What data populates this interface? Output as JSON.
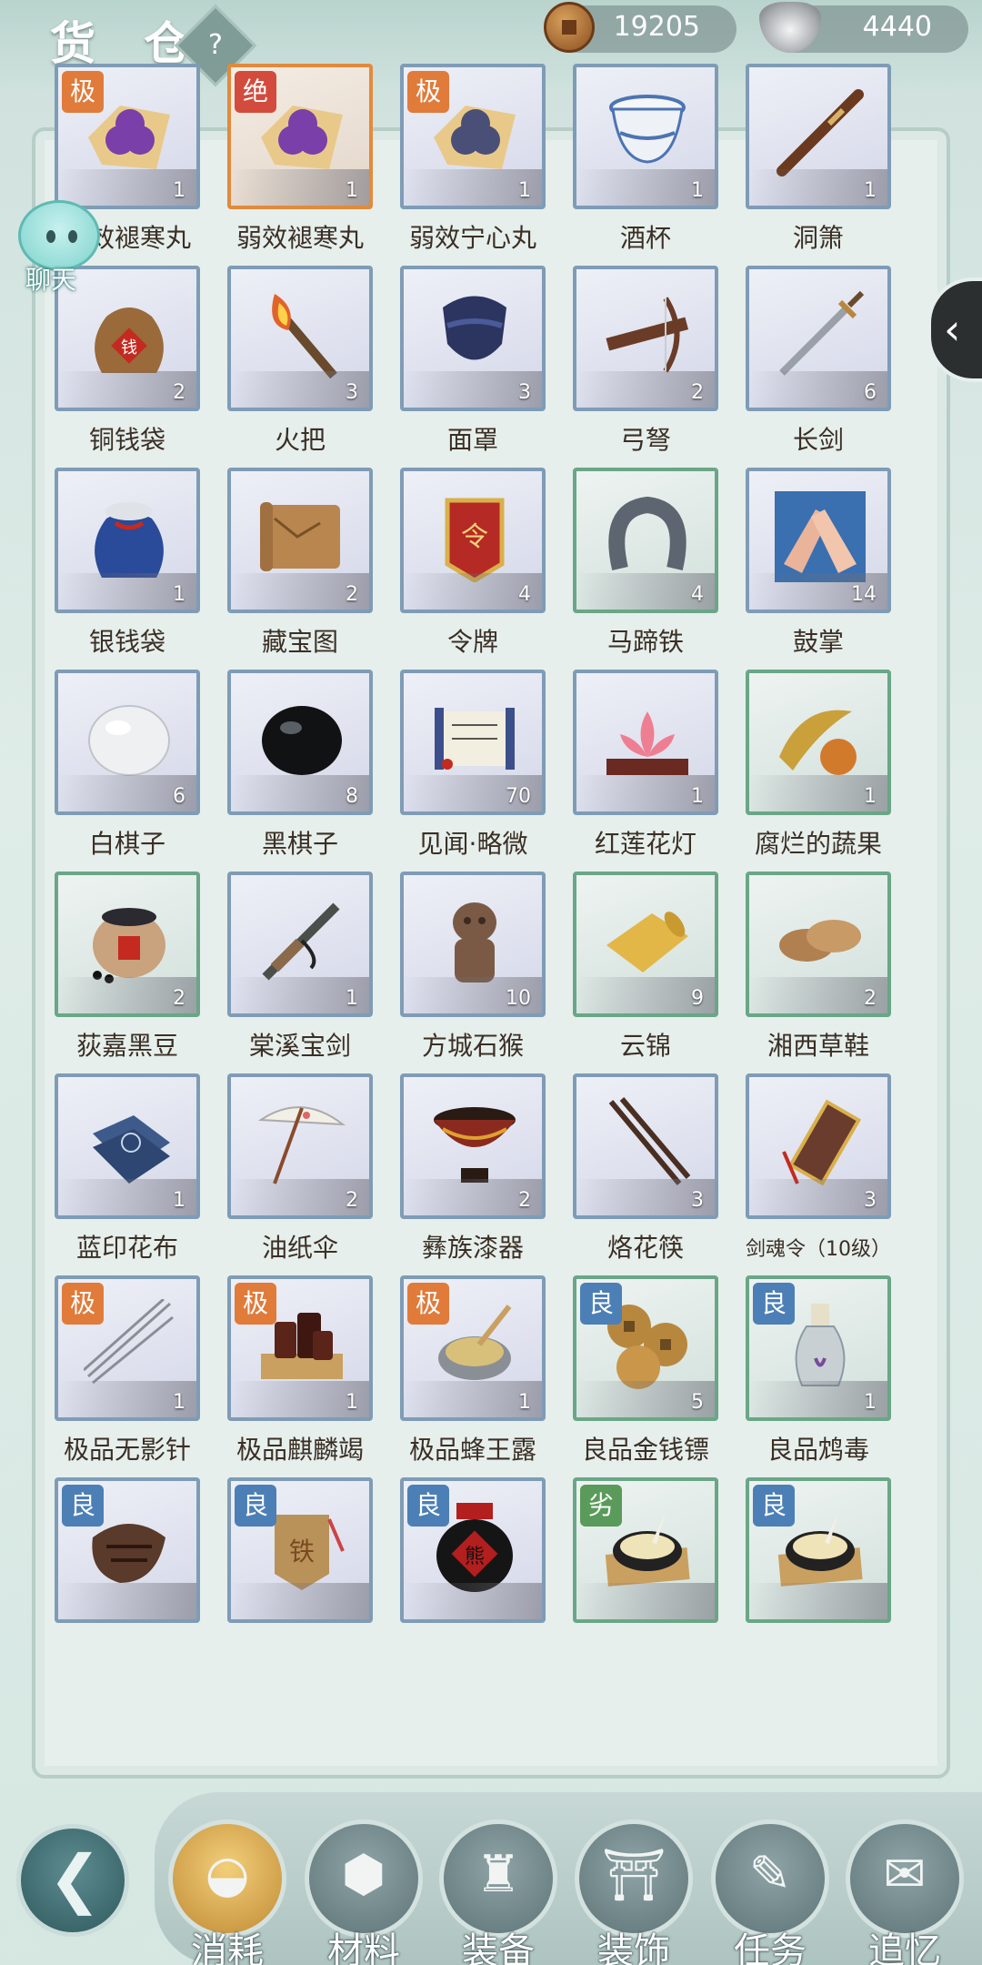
{
  "header": {
    "title": "货 仓",
    "help_label": "?"
  },
  "currency": {
    "coins": "19205",
    "silver": "4440"
  },
  "chat": {
    "label": "聊天"
  },
  "side_arrow": "‹",
  "items": [
    {
      "name": "弱效褪寒丸",
      "count": "1",
      "badge": "极",
      "badge_type": "ji",
      "rarity": "blue",
      "icon": "pill-icon",
      "color": "#7a3fa8"
    },
    {
      "name": "弱效褪寒丸",
      "count": "1",
      "badge": "绝",
      "badge_type": "jue",
      "rarity": "orange",
      "icon": "pill-icon",
      "color": "#7a3fa8"
    },
    {
      "name": "弱效宁心丸",
      "count": "1",
      "badge": "极",
      "badge_type": "ji",
      "rarity": "blue",
      "icon": "pill-icon",
      "color": "#4a4f78"
    },
    {
      "name": "酒杯",
      "count": "1",
      "badge": "",
      "badge_type": "",
      "rarity": "blue",
      "icon": "cup-icon",
      "color": "#4c74b3"
    },
    {
      "name": "洞箫",
      "count": "1",
      "badge": "",
      "badge_type": "",
      "rarity": "blue",
      "icon": "flute-icon",
      "color": "#6b3a1e"
    },
    {
      "name": "铜钱袋",
      "count": "2",
      "badge": "",
      "badge_type": "",
      "rarity": "blue",
      "icon": "money-bag-icon",
      "color": "#9a6a3a"
    },
    {
      "name": "火把",
      "count": "3",
      "badge": "",
      "badge_type": "",
      "rarity": "blue",
      "icon": "torch-icon",
      "color": "#e0632a"
    },
    {
      "name": "面罩",
      "count": "3",
      "badge": "",
      "badge_type": "",
      "rarity": "blue",
      "icon": "mask-icon",
      "color": "#2c3560"
    },
    {
      "name": "弓弩",
      "count": "2",
      "badge": "",
      "badge_type": "",
      "rarity": "blue",
      "icon": "crossbow-icon",
      "color": "#6a3c28"
    },
    {
      "name": "长剑",
      "count": "6",
      "badge": "",
      "badge_type": "",
      "rarity": "blue",
      "icon": "sword-icon",
      "color": "#9aa0a8"
    },
    {
      "name": "银钱袋",
      "count": "1",
      "badge": "",
      "badge_type": "",
      "rarity": "blue",
      "icon": "silver-bag-icon",
      "color": "#2a4a9a"
    },
    {
      "name": "藏宝图",
      "count": "2",
      "badge": "",
      "badge_type": "",
      "rarity": "blue",
      "icon": "map-icon",
      "color": "#b8864e"
    },
    {
      "name": "令牌",
      "count": "4",
      "badge": "",
      "badge_type": "",
      "rarity": "blue",
      "icon": "token-icon",
      "color": "#b52a24"
    },
    {
      "name": "马蹄铁",
      "count": "4",
      "badge": "",
      "badge_type": "",
      "rarity": "green",
      "icon": "horseshoe-icon",
      "color": "#5d6570"
    },
    {
      "name": "鼓掌",
      "count": "14",
      "badge": "",
      "badge_type": "",
      "rarity": "blue",
      "icon": "clap-icon",
      "color": "#e9b49a"
    },
    {
      "name": "白棋子",
      "count": "6",
      "badge": "",
      "badge_type": "",
      "rarity": "blue",
      "icon": "white-stone-icon",
      "color": "#eef0f2"
    },
    {
      "name": "黑棋子",
      "count": "8",
      "badge": "",
      "badge_type": "",
      "rarity": "blue",
      "icon": "black-stone-icon",
      "color": "#101214"
    },
    {
      "name": "见闻·略微",
      "count": "70",
      "badge": "",
      "badge_type": "",
      "rarity": "blue",
      "icon": "scroll-icon",
      "color": "#3c4f8a"
    },
    {
      "name": "红莲花灯",
      "count": "1",
      "badge": "",
      "badge_type": "",
      "rarity": "blue",
      "icon": "lotus-lamp-icon",
      "color": "#ee7f92"
    },
    {
      "name": "腐烂的蔬果",
      "count": "1",
      "badge": "",
      "badge_type": "",
      "rarity": "green",
      "icon": "rotten-fruit-icon",
      "color": "#c9a03a"
    },
    {
      "name": "荻嘉黑豆",
      "count": "2",
      "badge": "",
      "badge_type": "",
      "rarity": "green",
      "icon": "bean-jar-icon",
      "color": "#c9a27e"
    },
    {
      "name": "棠溪宝剑",
      "count": "1",
      "badge": "",
      "badge_type": "",
      "rarity": "blue",
      "icon": "sheathed-sword-icon",
      "color": "#4a4f4a"
    },
    {
      "name": "方城石猴",
      "count": "10",
      "badge": "",
      "badge_type": "",
      "rarity": "blue",
      "icon": "stone-monkey-icon",
      "color": "#7a5a45"
    },
    {
      "name": "云锦",
      "count": "9",
      "badge": "",
      "badge_type": "",
      "rarity": "green",
      "icon": "brocade-icon",
      "color": "#e2b748"
    },
    {
      "name": "湘西草鞋",
      "count": "2",
      "badge": "",
      "badge_type": "",
      "rarity": "green",
      "icon": "straw-shoes-icon",
      "color": "#b08050"
    },
    {
      "name": "蓝印花布",
      "count": "1",
      "badge": "",
      "badge_type": "",
      "rarity": "blue",
      "icon": "cloth-icon",
      "color": "#3d5a8a"
    },
    {
      "name": "油纸伞",
      "count": "2",
      "badge": "",
      "badge_type": "",
      "rarity": "blue",
      "icon": "umbrella-icon",
      "color": "#f1efe6"
    },
    {
      "name": "彝族漆器",
      "count": "2",
      "badge": "",
      "badge_type": "",
      "rarity": "blue",
      "icon": "lacquer-bowl-icon",
      "color": "#8a2a1e"
    },
    {
      "name": "烙花筷",
      "count": "3",
      "badge": "",
      "badge_type": "",
      "rarity": "blue",
      "icon": "chopsticks-icon",
      "color": "#4a2e22"
    },
    {
      "name": "剑魂令（10级）",
      "count": "3",
      "badge": "",
      "badge_type": "",
      "rarity": "blue",
      "icon": "sword-token-icon",
      "color": "#6a3c2e",
      "small": true
    },
    {
      "name": "极品无影针",
      "count": "1",
      "badge": "极",
      "badge_type": "ji",
      "rarity": "blue",
      "icon": "needle-icon",
      "color": "#8a8f96"
    },
    {
      "name": "极品麒麟竭",
      "count": "1",
      "badge": "极",
      "badge_type": "ji",
      "rarity": "blue",
      "icon": "resin-icon",
      "color": "#5a2418"
    },
    {
      "name": "极品蜂王露",
      "count": "1",
      "badge": "极",
      "badge_type": "ji",
      "rarity": "blue",
      "icon": "royal-jelly-icon",
      "color": "#d9c07a"
    },
    {
      "name": "良品金钱镖",
      "count": "5",
      "badge": "良",
      "badge_type": "liang",
      "rarity": "green",
      "icon": "coin-dart-icon",
      "color": "#b8873e"
    },
    {
      "name": "良品鸩毒",
      "count": "1",
      "badge": "良",
      "badge_type": "liang",
      "rarity": "green",
      "icon": "poison-bottle-icon",
      "color": "#c8d0d4"
    },
    {
      "name": "",
      "count": "",
      "badge": "良",
      "badge_type": "liang",
      "rarity": "blue",
      "icon": "dried-meat-icon",
      "color": "#5a3a2a"
    },
    {
      "name": "",
      "count": "",
      "badge": "良",
      "badge_type": "liang",
      "rarity": "blue",
      "icon": "iron-tag-icon",
      "color": "#b9925a"
    },
    {
      "name": "",
      "count": "",
      "badge": "良",
      "badge_type": "liang",
      "rarity": "blue",
      "icon": "wine-jar-icon",
      "color": "#6a1212"
    },
    {
      "name": "",
      "count": "",
      "badge": "劣",
      "badge_type": "lie",
      "rarity": "green",
      "icon": "soup-bowl-icon",
      "color": "#efe3b8"
    },
    {
      "name": "",
      "count": "",
      "badge": "良",
      "badge_type": "liang",
      "rarity": "green",
      "icon": "soup-bowl-icon",
      "color": "#efe3b8"
    }
  ],
  "nav": [
    {
      "label": "消耗",
      "glyph": "◒",
      "active": true
    },
    {
      "label": "材料",
      "glyph": "⬢",
      "active": false
    },
    {
      "label": "装备",
      "glyph": "♜",
      "active": false
    },
    {
      "label": "装饰",
      "glyph": "⛩",
      "active": false
    },
    {
      "label": "任务",
      "glyph": "✎",
      "active": false
    },
    {
      "label": "追忆",
      "glyph": "✉",
      "active": false
    }
  ],
  "back_label": "❮"
}
